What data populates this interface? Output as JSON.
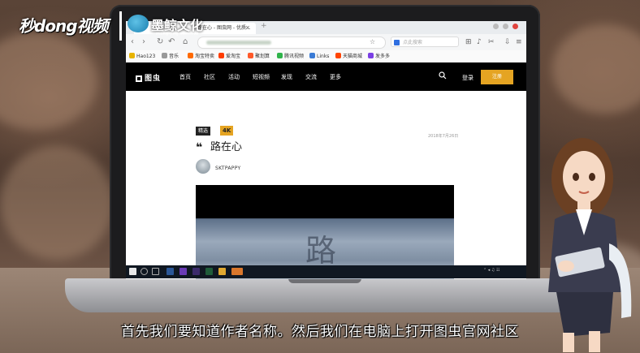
{
  "overlay": {
    "brand": "秒dong视频",
    "partner_name": "墨鲸文化",
    "partner_url": "mong-jing.com.hzz",
    "subtitle": "首先我们要知道作者名称。然后我们在电脑上打开图虫官网社区"
  },
  "browser": {
    "tab_title": "路在心 - 图虫网 - 优质...",
    "search_placeholder": "点此搜索",
    "bookmarks": [
      "Hao123",
      "音乐",
      "淘宝特卖",
      "爱淘宝",
      "聚划算",
      "腾讯视频",
      "Links",
      "天猫商城",
      "发多多"
    ],
    "bookmark_colors": [
      "#e8b400",
      "#999999",
      "#ff6a00",
      "#ff3d00",
      "#ff5a2a",
      "#2fb34a",
      "#3a7bd5",
      "#ff4400",
      "#7b3fe4"
    ]
  },
  "site": {
    "logo": "图虫",
    "nav": [
      "首页",
      "社区",
      "活动",
      "短视频",
      "发现",
      "交流",
      "更多"
    ],
    "login": "登录",
    "register": "注册"
  },
  "post": {
    "badge_pick": "精选",
    "badge_4k": "4K",
    "quote_mark": "❝",
    "title": "路在心",
    "date": "2018年7月26日",
    "author": "SKTPAPPY",
    "photo_char": "路"
  }
}
